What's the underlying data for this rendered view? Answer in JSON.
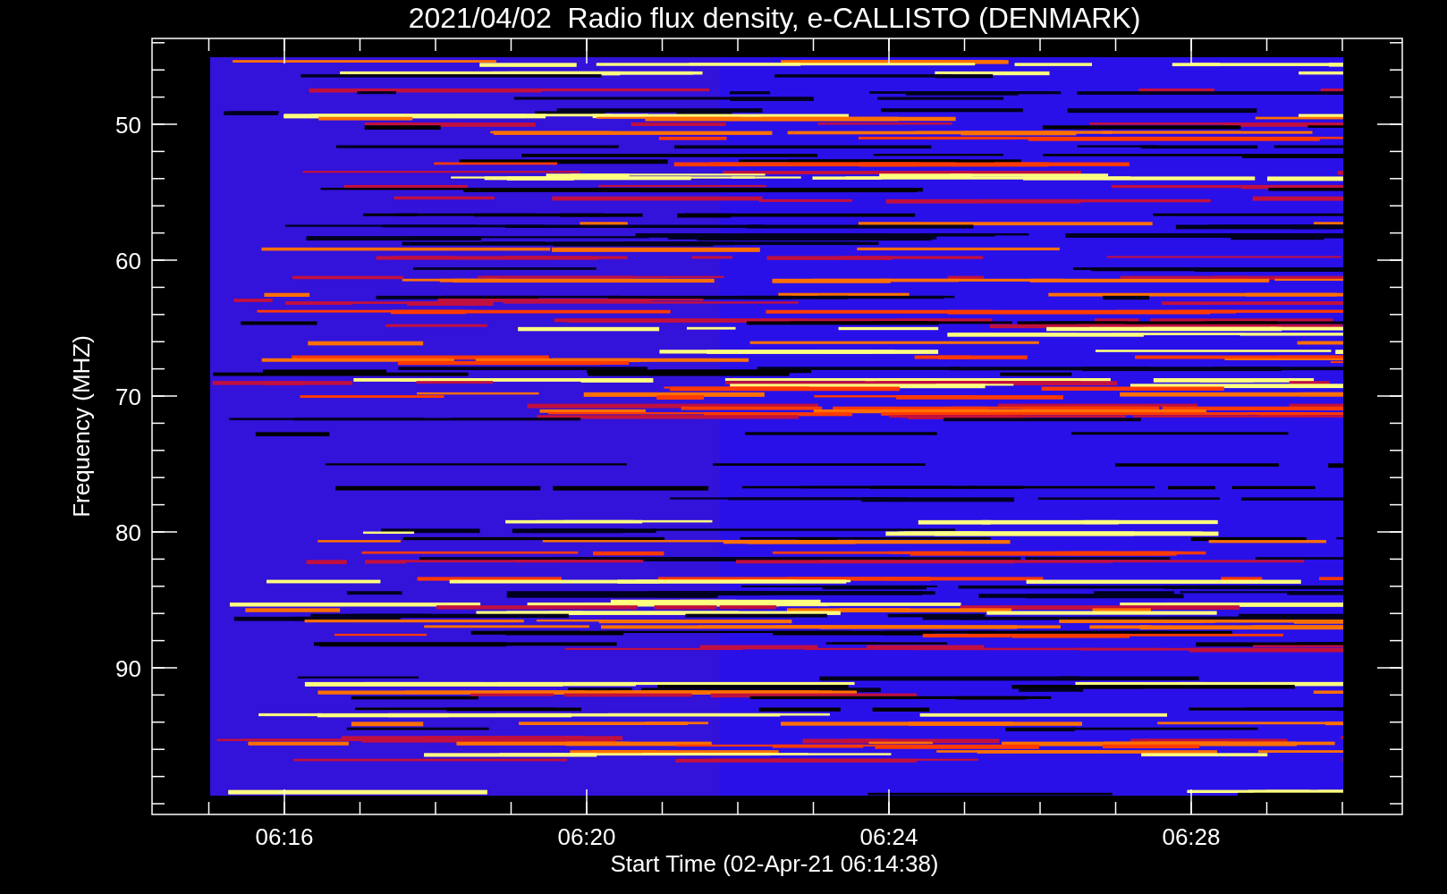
{
  "title": "2021/04/02  Radio flux density, e-CALLISTO (DENMARK)",
  "y_axis": {
    "label": "Frequency (MHZ)",
    "ticks": [
      "50",
      "60",
      "70",
      "80",
      "90"
    ]
  },
  "x_axis": {
    "label": "Start Time (02-Apr-21 06:14:38)",
    "ticks": [
      "06:16",
      "06:20",
      "06:24",
      "06:28"
    ]
  }
}
